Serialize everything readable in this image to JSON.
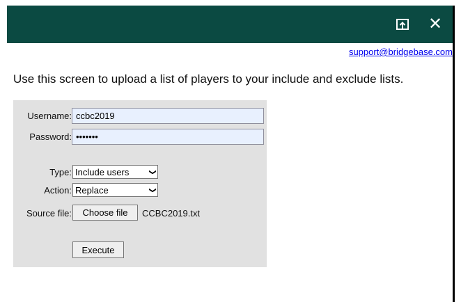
{
  "titlebar": {
    "background": "#0b4a42",
    "popout_icon": "popout-icon",
    "close_glyph": "✕"
  },
  "support_link": "support@bridgebase.com",
  "intro_text": "Use this screen to upload a list of players to your include and exclude lists.",
  "form": {
    "username_label": "Username:",
    "username_value": "ccbc2019",
    "password_label": "Password:",
    "password_value": "•••••••",
    "type_label": "Type:",
    "type_selected": "Include users",
    "action_label": "Action:",
    "action_selected": "Replace",
    "source_label": "Source file:",
    "choose_file_label": "Choose file",
    "file_name": "CCBC2019.txt",
    "execute_label": "Execute"
  }
}
